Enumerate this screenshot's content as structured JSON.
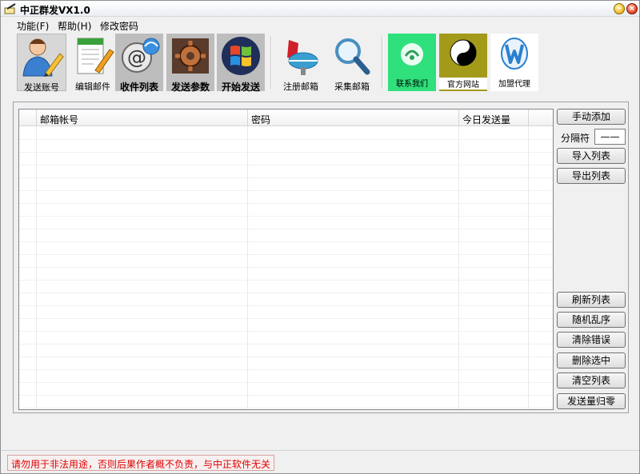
{
  "app": {
    "title": "中正群发VX1.0"
  },
  "window_controls": {
    "minimize_glyph": "–",
    "close_glyph": "×"
  },
  "menu": {
    "items": [
      {
        "label": "功能(F)"
      },
      {
        "label": "帮助(H)"
      },
      {
        "label": "修改密码"
      }
    ]
  },
  "toolbar": {
    "send_account": {
      "label": "发送账号",
      "icon": "user-edit-icon"
    },
    "edit_mail": {
      "label": "编辑邮件",
      "icon": "document-edit-icon"
    },
    "recipient_list": {
      "label": "收件列表",
      "icon": "email-at-icon"
    },
    "send_params": {
      "label": "发送参数",
      "icon": "gear-icon"
    },
    "start_send": {
      "label": "开始发送",
      "icon": "windows-logo-icon"
    },
    "register_mail": {
      "label": "注册邮箱",
      "icon": "mailbox-icon"
    },
    "collect_mail": {
      "label": "采集邮箱",
      "icon": "magnifier-icon"
    },
    "contact_us": {
      "label": "联系我们",
      "icon": "satellite-icon"
    },
    "official_site": {
      "label": "官方网站",
      "icon": "yin-yang-icon"
    },
    "join_agent": {
      "label": "加盟代理",
      "icon": "w-logo-icon"
    }
  },
  "grid": {
    "columns": [
      {
        "label": ""
      },
      {
        "label": "邮箱帐号"
      },
      {
        "label": "密码"
      },
      {
        "label": "今日发送量"
      }
    ],
    "rows": []
  },
  "side_panel": {
    "manual_add": "手动添加",
    "separator_label": "分隔符",
    "separator_value": "——",
    "import_list": "导入列表",
    "export_list": "导出列表",
    "refresh_list": "刷新列表",
    "shuffle": "随机乱序",
    "clear_errors": "清除错误",
    "delete_selected": "删除选中",
    "clear_list": "清空列表",
    "reset_count": "发送量归零"
  },
  "status": {
    "warning": "请勿用于非法用途，否则后果作者概不负责，与中正软件无关"
  },
  "colors": {
    "warning_text": "#e00000",
    "contact_tile": "#2fe07c",
    "official_tile": "#a39a1a"
  }
}
